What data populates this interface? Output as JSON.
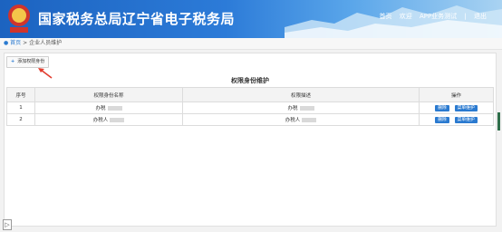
{
  "header": {
    "title": "国家税务总局辽宁省电子税务局",
    "nav": [
      "首页",
      "欢迎",
      "APP业务测试",
      "|",
      "退出"
    ]
  },
  "breadcrumb": {
    "home": "首页",
    "separator": ">",
    "current": "企业人员维护"
  },
  "toolbar": {
    "add_label": "添加权限身份",
    "add_icon": "+"
  },
  "table": {
    "title": "权限身份维护",
    "headers": [
      "序号",
      "权限身份名称",
      "权限描述",
      "操作"
    ],
    "rows": [
      {
        "index": "1",
        "name": "办税",
        "desc": "办税"
      },
      {
        "index": "2",
        "name": "办税人",
        "desc": "办税人"
      }
    ],
    "delete_label": "删除",
    "menu_label": "菜单维护"
  },
  "colors": {
    "header_blue": "#1c63c0",
    "button_blue": "#2a7ad0",
    "arrow_red": "#e23c2e"
  }
}
